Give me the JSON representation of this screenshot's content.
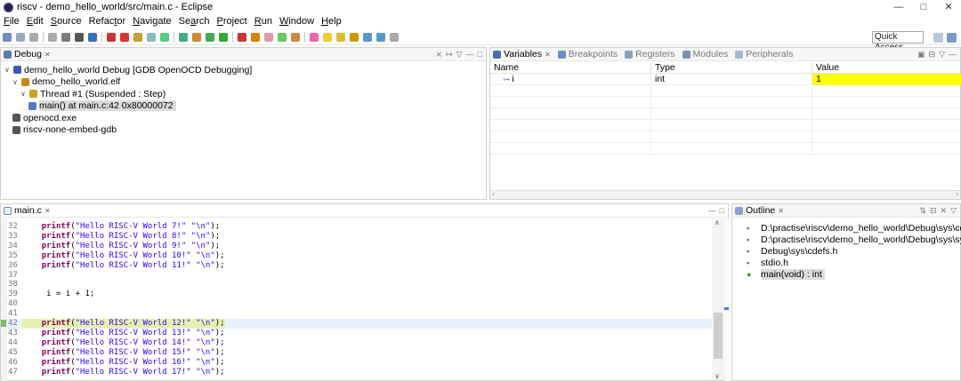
{
  "window": {
    "title": "riscv - demo_hello_world/src/main.c - Eclipse",
    "controls": [
      "—",
      "□",
      "✕"
    ]
  },
  "menu": [
    {
      "label": "File",
      "u": "F",
      "rest": "ile"
    },
    {
      "label": "Edit",
      "u": "E",
      "rest": "dit"
    },
    {
      "label": "Source",
      "u": "S",
      "rest": "ource"
    },
    {
      "label": "Refactor",
      "pre": "Refac",
      "u": "t",
      "rest": "or"
    },
    {
      "label": "Navigate",
      "u": "N",
      "rest": "avigate"
    },
    {
      "label": "Search",
      "pre": "Se",
      "u": "a",
      "rest": "rch"
    },
    {
      "label": "Project",
      "u": "P",
      "rest": "roject"
    },
    {
      "label": "Run",
      "u": "R",
      "rest": "un"
    },
    {
      "label": "Window",
      "u": "W",
      "rest": "indow"
    },
    {
      "label": "Help",
      "u": "H",
      "rest": "elp"
    }
  ],
  "toolbar": {
    "quick_access": "Quick Access"
  },
  "debug_view": {
    "tab_label": "Debug",
    "tree": [
      {
        "level": 0,
        "twisty": "∨",
        "label": "demo_hello_world Debug [GDB OpenOCD Debugging]",
        "icon_color": "#3b5ba8"
      },
      {
        "level": 1,
        "twisty": "∨",
        "label": "demo_hello_world.elf",
        "icon_color": "#c8891a"
      },
      {
        "level": 2,
        "twisty": "∨",
        "label": "Thread #1 (Suspended : Step)",
        "icon_color": "#d0a020"
      },
      {
        "level": 3,
        "twisty": "",
        "label": "main() at main.c:42 0x80000072",
        "icon_color": "#5a79b8",
        "selected": true
      },
      {
        "level": 1,
        "twisty": "",
        "label": "openocd.exe",
        "icon_color": "#555555"
      },
      {
        "level": 1,
        "twisty": "",
        "label": "riscv-none-embed-gdb",
        "icon_color": "#555555"
      }
    ]
  },
  "variables_view": {
    "tabs": [
      {
        "label": "Variables",
        "active": true,
        "close": "✕"
      },
      {
        "label": "Breakpoints",
        "active": false
      },
      {
        "label": "Registers",
        "active": false
      },
      {
        "label": "Modules",
        "active": false
      },
      {
        "label": "Peripherals",
        "active": false
      }
    ],
    "columns": [
      "Name",
      "Type",
      "Value"
    ],
    "rows": [
      {
        "name": "i",
        "type": "int",
        "value": "1",
        "changed": true
      }
    ],
    "highlight_color": "#ffff00"
  },
  "editor": {
    "tab_label": "main.c",
    "lines": [
      {
        "n": "32",
        "indent": "    ",
        "kind": "printf",
        "str": "\"Hello RISC-V World 7!\" \"\\n\""
      },
      {
        "n": "33",
        "indent": "    ",
        "kind": "printf",
        "str": "\"Hello RISC-V World 8!\" \"\\n\""
      },
      {
        "n": "34",
        "indent": "    ",
        "kind": "printf",
        "str": "\"Hello RISC-V World 9!\" \"\\n\""
      },
      {
        "n": "35",
        "indent": "    ",
        "kind": "printf",
        "str": "\"Hello RISC-V World 10!\" \"\\n\""
      },
      {
        "n": "36",
        "indent": "    ",
        "kind": "printf",
        "str": "\"Hello RISC-V World 11!\" \"\\n\""
      },
      {
        "n": "37",
        "indent": "",
        "kind": "blank",
        "str": ""
      },
      {
        "n": "38",
        "indent": "",
        "kind": "blank",
        "str": ""
      },
      {
        "n": "39",
        "indent": "     ",
        "kind": "plain",
        "str": "i = i + 1;"
      },
      {
        "n": "40",
        "indent": "",
        "kind": "blank",
        "str": ""
      },
      {
        "n": "41",
        "indent": "",
        "kind": "blank",
        "str": ""
      },
      {
        "n": "42",
        "indent": "    ",
        "kind": "printf",
        "str": "\"Hello RISC-V World 12!\" \"\\n\"",
        "current": true
      },
      {
        "n": "43",
        "indent": "    ",
        "kind": "printf",
        "str": "\"Hello RISC-V World 13!\" \"\\n\""
      },
      {
        "n": "44",
        "indent": "    ",
        "kind": "printf",
        "str": "\"Hello RISC-V World 14!\" \"\\n\""
      },
      {
        "n": "45",
        "indent": "    ",
        "kind": "printf",
        "str": "\"Hello RISC-V World 15!\" \"\\n\""
      },
      {
        "n": "46",
        "indent": "    ",
        "kind": "printf",
        "str": "\"Hello RISC-V World 16!\" \"\\n\""
      },
      {
        "n": "47",
        "indent": "    ",
        "kind": "printf",
        "str": "\"Hello RISC-V World 17!\" \"\\n\""
      }
    ]
  },
  "outline_view": {
    "tab_label": "Outline",
    "items": [
      {
        "icon": "▪",
        "label": "D:\\practise\\riscv\\demo_hello_world\\Debug\\sys\\cdefs."
      },
      {
        "icon": "▪",
        "label": "D:\\practise\\riscv\\demo_hello_world\\Debug\\sys\\sys"
      },
      {
        "icon": "▪",
        "label": "Debug\\sys\\cdefs.h"
      },
      {
        "icon": "▪",
        "label": "stdio.h"
      },
      {
        "icon": "●",
        "label": "main(void) : int",
        "selected": true
      }
    ]
  }
}
